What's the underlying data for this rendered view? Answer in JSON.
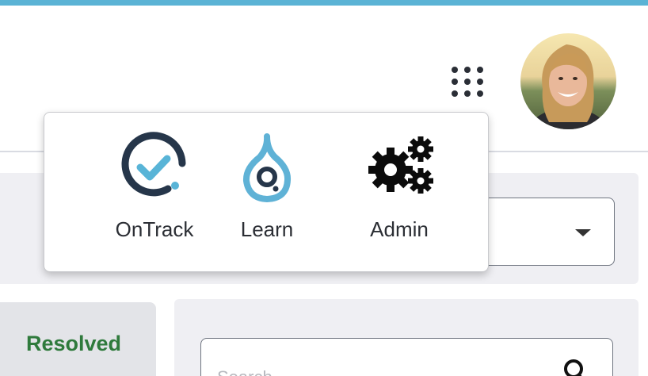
{
  "header": {
    "apps_menu_icon": "app-grid-icon",
    "avatar_alt": "User profile photo"
  },
  "app_menu": {
    "items": [
      {
        "label": "OnTrack",
        "icon": "ontrack-check-icon",
        "colors": {
          "ring": "#26364a",
          "accent": "#58b4d7"
        }
      },
      {
        "label": "Learn",
        "icon": "learn-drop-icon",
        "colors": {
          "drop": "#5fb2d6",
          "ring": "#26364a"
        }
      },
      {
        "label": "Admin",
        "icon": "gears-icon",
        "colors": {
          "gear": "#0b0b0b"
        }
      }
    ]
  },
  "filters": {
    "select_value": "",
    "select_icon": "caret-down-icon"
  },
  "tabs": {
    "resolved_label": "Resolved"
  },
  "search": {
    "placeholder": "Search",
    "icon": "search-icon"
  },
  "colors": {
    "top_stripe": "#5bb3d5",
    "resolved_text": "#2f7a3c",
    "panel_bg": "#efeff3"
  }
}
